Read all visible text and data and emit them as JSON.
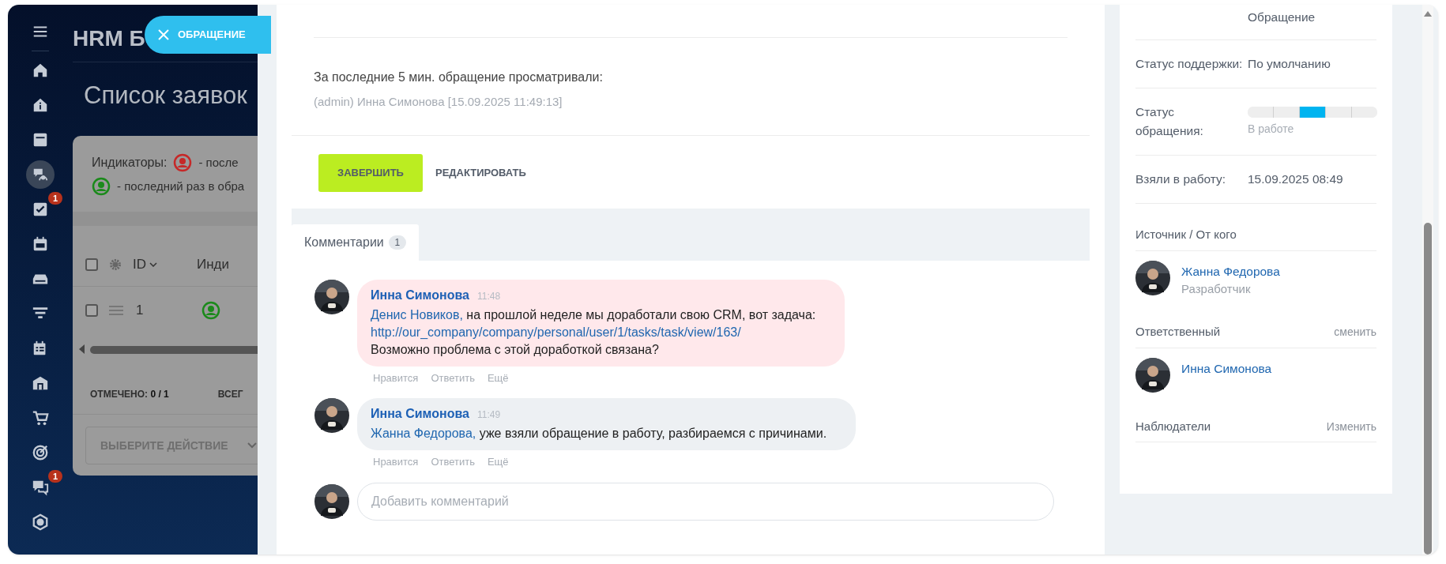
{
  "tab_button": {
    "label": "ОБРАЩЕНИЕ"
  },
  "sidebar": {
    "items": [
      {
        "selected": false
      },
      {
        "selected": false
      },
      {
        "selected": false
      },
      {
        "selected": false
      },
      {
        "selected": true
      },
      {
        "selected": false,
        "badge": "1"
      },
      {
        "selected": false
      },
      {
        "selected": false
      },
      {
        "selected": false
      },
      {
        "selected": false
      },
      {
        "selected": false
      },
      {
        "selected": false
      },
      {
        "selected": false
      },
      {
        "selected": false,
        "badge": "1"
      },
      {
        "selected": false
      }
    ]
  },
  "background_page": {
    "app_title": "HRM Б",
    "page_title": "Список заявок",
    "indicators_label": "Индикаторы:",
    "indicators": [
      {
        "color": "#c62828",
        "text": "- после"
      },
      {
        "color": "#1b8a1b",
        "text": "- последний раз в обра"
      }
    ],
    "table": {
      "header_checked": false,
      "columns": [
        "ID",
        "Инди"
      ],
      "rows": [
        {
          "id": "1",
          "checked": false
        }
      ]
    },
    "footer": {
      "marked_label": "ОТМЕЧЕНО:",
      "marked_value": "0 / 1",
      "total_label": "ВСЕГ"
    },
    "action_select": {
      "placeholder": "ВЫБЕРИТЕ ДЕЙСТВИЕ"
    }
  },
  "viewers": {
    "title": "За последние 5 мин. обращение просматривали:",
    "entries": [
      "(admin) Инна Симонова [15.09.2025 11:49:13]"
    ]
  },
  "actions": [
    {
      "label": "ЗАВЕРШИТЬ",
      "kind": "primary"
    },
    {
      "label": "РЕДАКТИРОВАТЬ",
      "kind": "link"
    }
  ],
  "tabs": [
    {
      "label": "Комментарии",
      "count": "1",
      "selected": true
    }
  ],
  "comments": [
    {
      "author": "Инна Симонова",
      "time": "11:48",
      "highlighted": true,
      "lines": [
        [
          {
            "kind": "mention",
            "text": "Денис Новиков,"
          },
          {
            "kind": "text",
            "text": " на прошлой неделе мы доработали свою CRM, вот задача:"
          }
        ],
        [
          {
            "kind": "link",
            "text": "http://our_company/company/personal/user/1/tasks/task/view/163/"
          }
        ],
        [
          {
            "kind": "text",
            "text": "Возможно проблема с этой доработкой связана?"
          }
        ]
      ],
      "actions": [
        "Нравится",
        "Ответить",
        "Ещё"
      ]
    },
    {
      "author": "Инна Симонова",
      "time": "11:49",
      "highlighted": false,
      "lines": [
        [
          {
            "kind": "mention",
            "text": "Жанна Федорова,"
          },
          {
            "kind": "text",
            "text": " уже взяли обращение в работу, разбираемся с причинами."
          }
        ]
      ],
      "actions": [
        "Нравится",
        "Ответить",
        "Ещё"
      ]
    }
  ],
  "comment_input": {
    "placeholder": "Добавить комментарий"
  },
  "details": {
    "rows": [
      {
        "kind": "text",
        "value": "Обращение"
      },
      {
        "kind": "text",
        "label": "Статус поддержки:",
        "value": "По умолчанию"
      },
      {
        "kind": "stages",
        "label": "Статус обращения:",
        "stages": [
          {
            "current": false
          },
          {
            "current": false
          },
          {
            "current": true
          },
          {
            "current": false
          },
          {
            "current": false
          }
        ],
        "value": "В работе"
      },
      {
        "kind": "text",
        "label": "Взяли в работу:",
        "value": "15.09.2025 08:49"
      }
    ]
  },
  "people_sections": [
    {
      "title": "Источник / От кого",
      "people": [
        {
          "name": "Жанна Федорова",
          "role": "Разработчик"
        }
      ]
    },
    {
      "title": "Ответственный",
      "action": "сменить",
      "people": [
        {
          "name": "Инна Симонова"
        }
      ]
    },
    {
      "title": "Наблюдатели",
      "action": "Изменить"
    }
  ]
}
